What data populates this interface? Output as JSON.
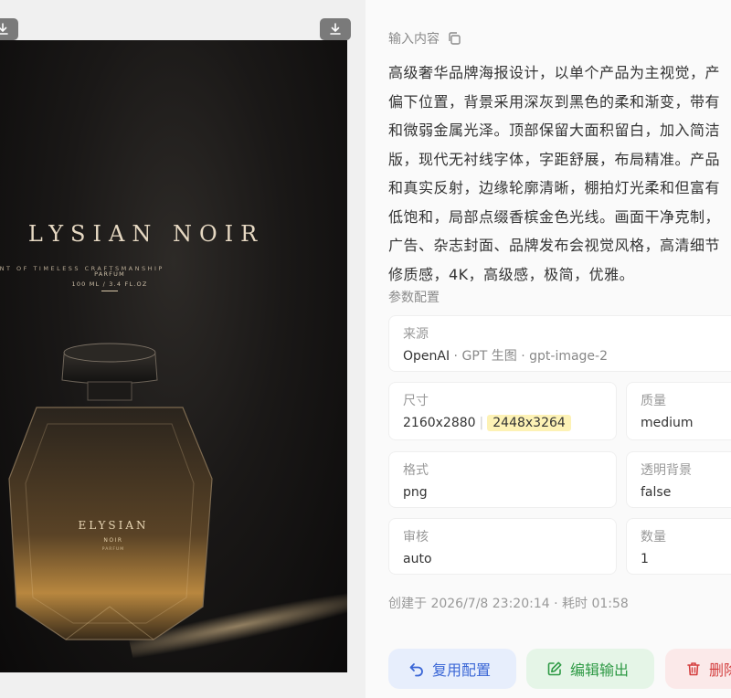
{
  "poster": {
    "brand_title": "LYSIAN NOIR",
    "tagline": "CENT OF TIMELESS CRAFTSMANSHIP",
    "product_type": "PARFUM",
    "volume": "100 ML / 3.4 FL.OZ",
    "bottle_brand": "ELYSIAN",
    "bottle_sub": "NOIR",
    "bottle_type": "PARFUM"
  },
  "details": {
    "input_label": "输入内容",
    "prompt_lines": [
      "高级奢华品牌海报设计，以单个产品为主视觉，产",
      "偏下位置，背景采用深灰到黑色的柔和渐变，带有",
      "和微弱金属光泽。顶部保留大面积留白，加入简洁",
      "版，现代无衬线字体，字距舒展，布局精准。产品",
      "和真实反射，边缘轮廓清晰，棚拍灯光柔和但富有",
      "低饱和，局部点缀香槟金色光线。画面干净克制，",
      "广告、杂志封面、品牌发布会视觉风格，高清细节",
      "修质感，4K，高级感，极简，优雅。"
    ],
    "params_label": "参数配置",
    "source": {
      "label": "来源",
      "provider": "OpenAI",
      "tool": "GPT 生图",
      "model": "gpt-image-2"
    },
    "size": {
      "label": "尺寸",
      "value": "2160x2880",
      "actual": "2448x3264"
    },
    "quality": {
      "label": "质量",
      "value": "medium"
    },
    "format": {
      "label": "格式",
      "value": "png"
    },
    "transparent": {
      "label": "透明背景",
      "value": "false"
    },
    "moderation": {
      "label": "审核",
      "value": "auto"
    },
    "count": {
      "label": "数量",
      "value": "1"
    },
    "created": "创建于 2026/7/8 23:20:14 · 耗时 01:58"
  },
  "actions": {
    "reuse": "复用配置",
    "edit": "编辑输出",
    "delete": "删除"
  },
  "colors": {
    "reuse_accent": "#3a66d6",
    "edit_accent": "#2e9a45",
    "delete_accent": "#d43f3f",
    "size_highlight": "#fdf2b5"
  }
}
